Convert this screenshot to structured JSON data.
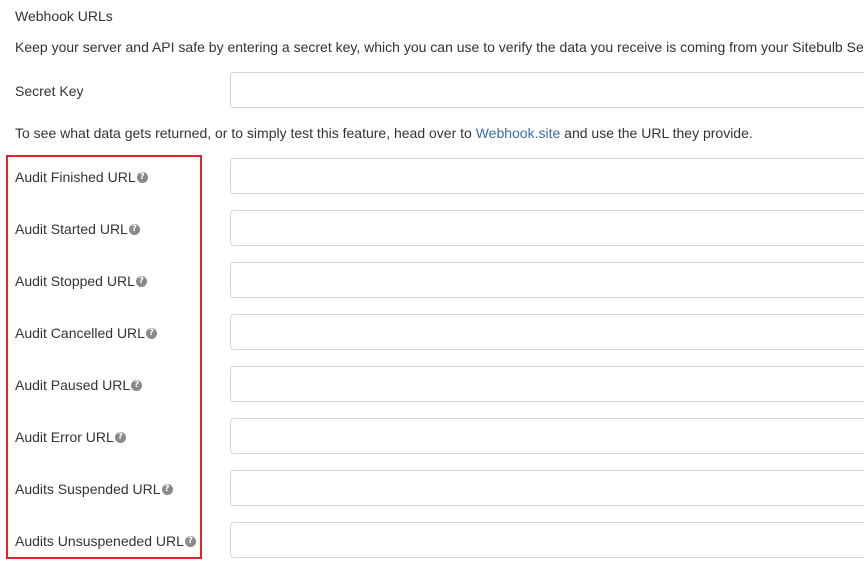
{
  "section": {
    "title": "Webhook URLs",
    "intro": "Keep your server and API safe by entering a secret key, which you can use to verify the data you receive is coming from your Sitebulb Server."
  },
  "secret": {
    "label": "Secret Key",
    "value": "",
    "placeholder": ""
  },
  "note": {
    "before": "To see what data gets returned, or to simply test this feature, head over to ",
    "link": "Webhook.site",
    "after": " and use the URL they provide."
  },
  "help_icon": {
    "name": "question-circle-icon",
    "glyph": "?"
  },
  "webhooks": [
    {
      "label": "Audit Finished URL",
      "value": ""
    },
    {
      "label": "Audit Started URL",
      "value": ""
    },
    {
      "label": "Audit Stopped URL",
      "value": ""
    },
    {
      "label": "Audit Cancelled URL",
      "value": ""
    },
    {
      "label": "Audit Paused URL",
      "value": ""
    },
    {
      "label": "Audit Error URL",
      "value": ""
    },
    {
      "label": "Audits Suspended URL",
      "value": ""
    },
    {
      "label": "Audits Unsuspeneded URL",
      "value": ""
    }
  ],
  "colors": {
    "highlight": "#e02424",
    "link": "#3a6ea8",
    "input_border": "#d6d6d6",
    "help_icon": "#8a8a8a"
  }
}
